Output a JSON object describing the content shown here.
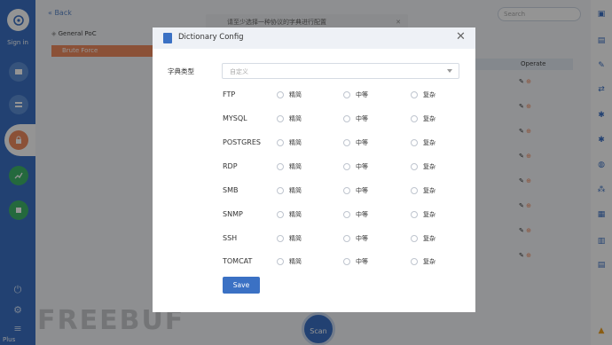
{
  "sidebar": {
    "signin_label": "Sign in",
    "bottom_label": "Plus"
  },
  "background": {
    "back_label": "Back",
    "menu": [
      {
        "label": "General PoC"
      },
      {
        "label": "Brute Force"
      }
    ],
    "toast_text": "请至少选择一种协议的字典进行配置",
    "search_placeholder": "Search",
    "operate_header": "Operate",
    "scan_label": "Scan",
    "watermark": "FREEBUF"
  },
  "modal": {
    "title": "Dictionary Config",
    "close_glyph": "✕",
    "type_label": "字典类型",
    "type_value": "自定义",
    "options": [
      "精简",
      "中等",
      "复杂"
    ],
    "protocols": [
      "FTP",
      "MYSQL",
      "POSTGRES",
      "RDP",
      "SMB",
      "SNMP",
      "SSH",
      "TOMCAT"
    ],
    "save_label": "Save"
  },
  "colors": {
    "primary": "#3b71c4",
    "accent": "#f08c5f"
  }
}
